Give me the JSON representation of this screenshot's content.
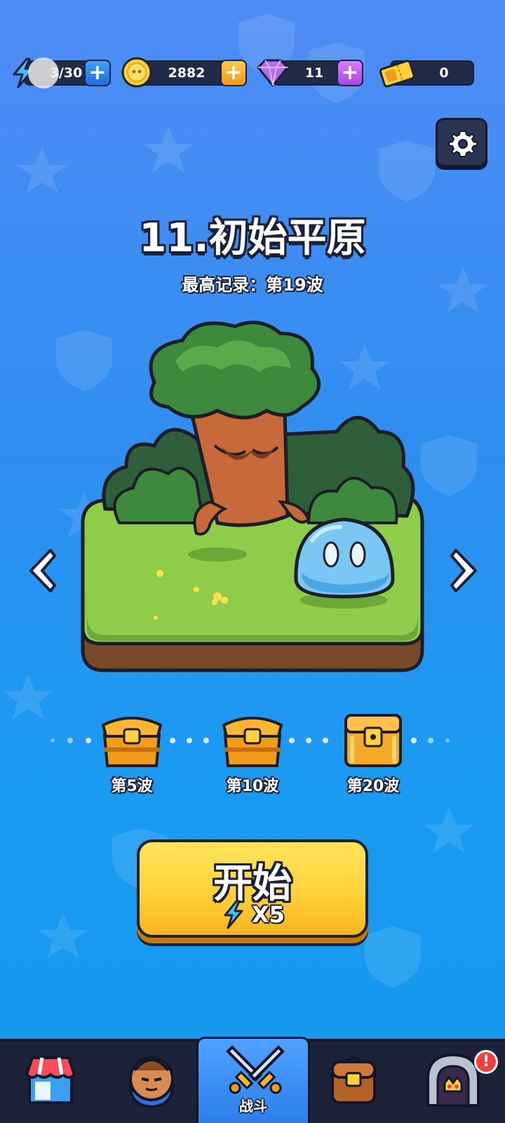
{
  "resources": {
    "energy": {
      "value": "3/30"
    },
    "coins": {
      "value": "2882"
    },
    "gems": {
      "value": "11"
    },
    "tickets": {
      "value": "0"
    }
  },
  "level": {
    "title": "11.初始平原",
    "record": "最高记录：第19波"
  },
  "milestones": [
    {
      "label": "第5波"
    },
    {
      "label": "第10波"
    },
    {
      "label": "第20波"
    }
  ],
  "start_button": {
    "label": "开始",
    "cost": "X5"
  },
  "nav": {
    "battle_label": "战斗",
    "badge": "!"
  },
  "colors": {
    "accent": "#ffd23a",
    "background": "#2f8ef0",
    "nav_bg": "#1c2237",
    "badge": "#ff3b3b"
  },
  "icons": {
    "energy": "lightning-icon",
    "coins": "coin-icon",
    "gems": "gem-icon",
    "tickets": "ticket-icon",
    "settings": "gear-icon"
  }
}
